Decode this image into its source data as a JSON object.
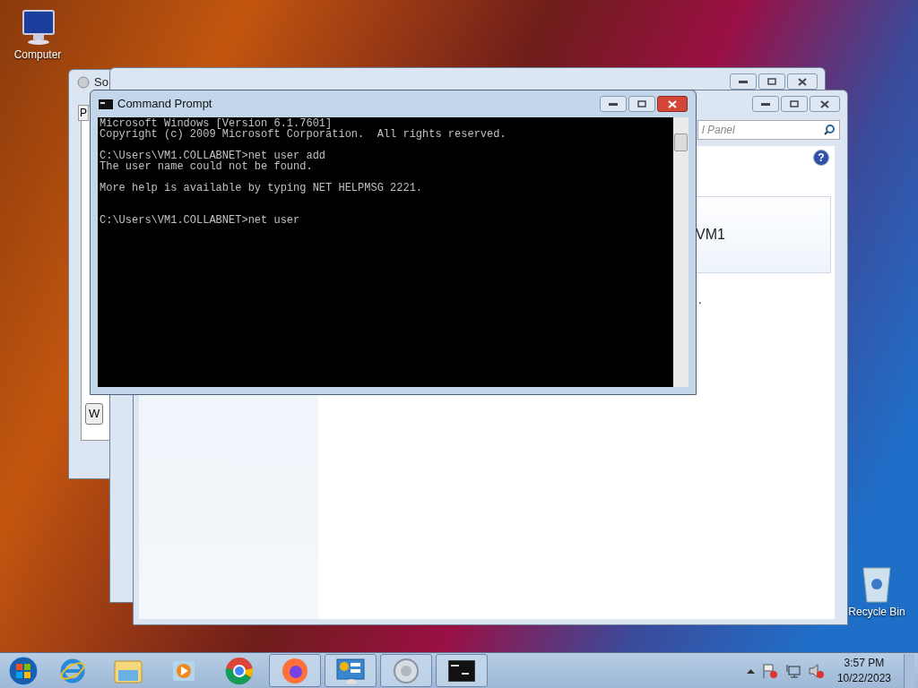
{
  "desktop_icons": [
    {
      "kind": "computer",
      "label": "Computer"
    },
    {
      "kind": "recycle",
      "label": "Recycle Bin"
    }
  ],
  "sound_window": {
    "title": "So",
    "tab": "P",
    "button": "W"
  },
  "control_panel": {
    "search_placeholder": "l Panel",
    "help_glyph": "?",
    "account_name": "VM1",
    "text_fragment": "."
  },
  "command_prompt": {
    "title": "Command Prompt",
    "blocks": [
      {
        "kind": "banner",
        "lines": [
          "Microsoft Windows [Version 6.1.7601]",
          "Copyright (c) 2009 Microsoft Corporation.  All rights reserved."
        ]
      },
      {
        "kind": "command",
        "lines": [
          "C:\\Users\\VM1.COLLABNET>net user add",
          "The user name could not be found."
        ]
      },
      {
        "kind": "message",
        "lines": [
          "More help is available by typing NET HELPMSG 2221."
        ]
      },
      {
        "kind": "prompt",
        "lines": [
          "C:\\Users\\VM1.COLLABNET>net user"
        ]
      }
    ]
  },
  "taskbar": {
    "items": [
      {
        "kind": "ie",
        "running": false
      },
      {
        "kind": "explorer",
        "running": false
      },
      {
        "kind": "media",
        "running": false
      },
      {
        "kind": "chrome",
        "running": false
      },
      {
        "kind": "firefox",
        "running": true
      },
      {
        "kind": "controlpanel",
        "running": true
      },
      {
        "kind": "sound",
        "running": true
      },
      {
        "kind": "cmd",
        "running": true
      }
    ],
    "clock_time": "3:57 PM",
    "clock_date": "10/22/2023"
  }
}
